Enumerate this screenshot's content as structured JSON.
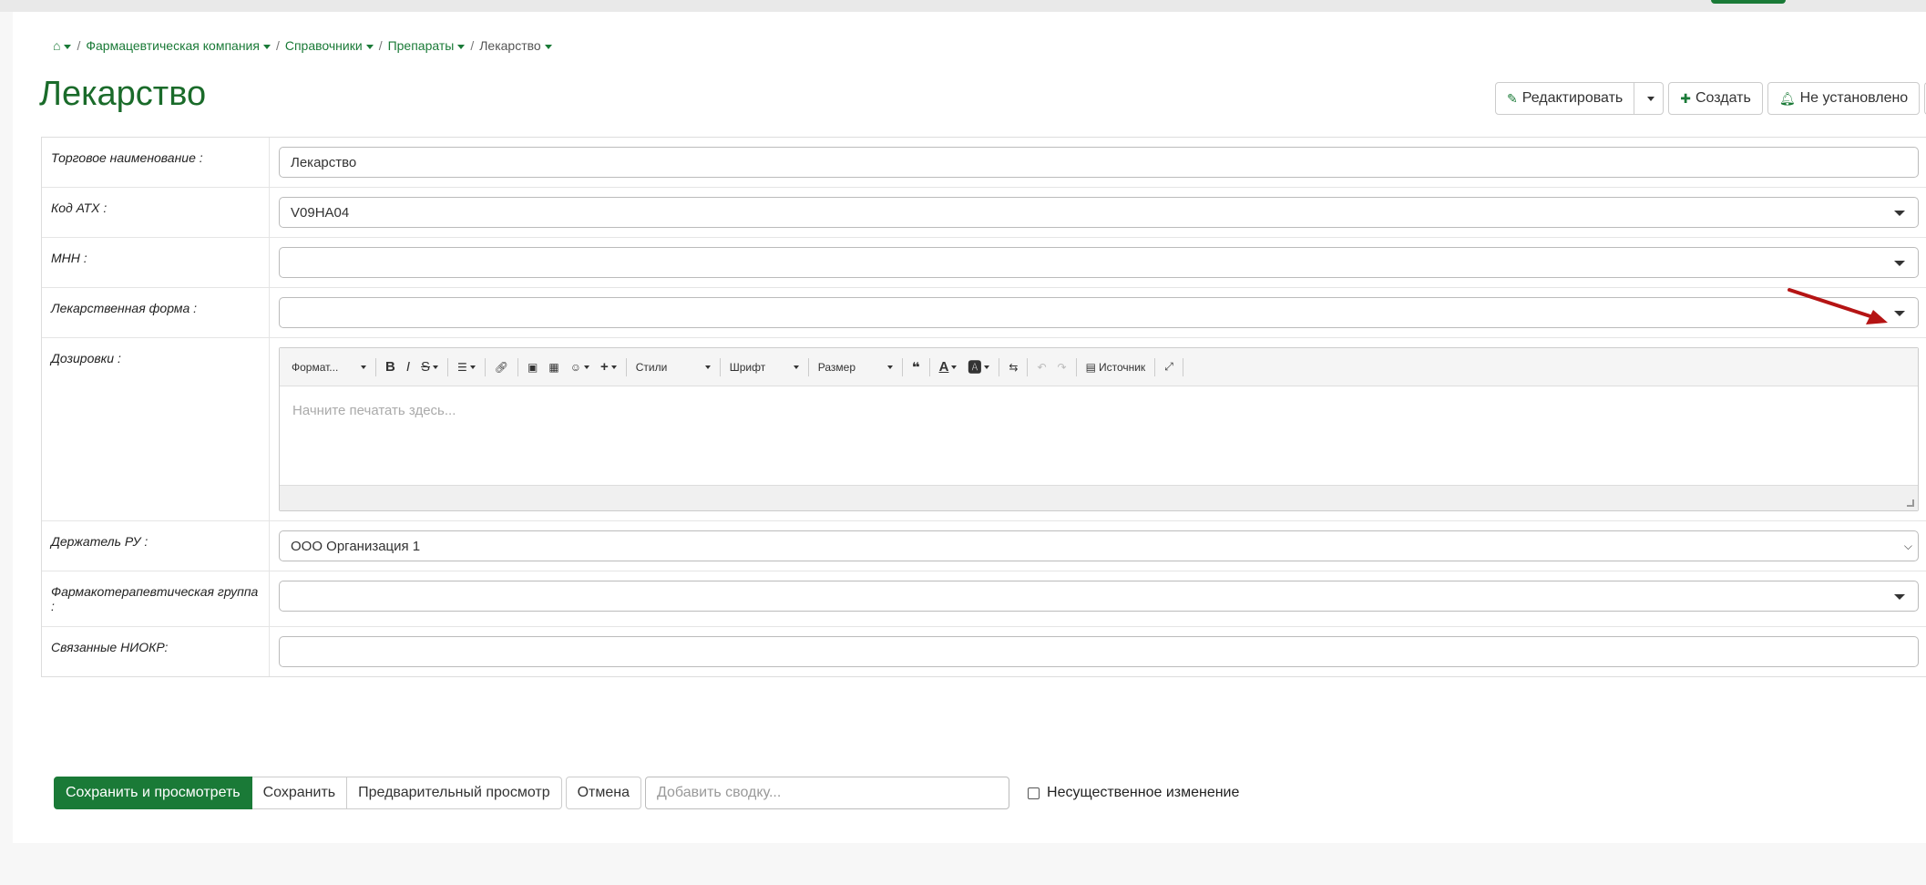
{
  "breadcrumb": {
    "items": [
      "Фармацевтическая компания",
      "Справочники",
      "Препараты"
    ],
    "current": "Лекарство"
  },
  "page": {
    "title": "Лекарство"
  },
  "actions": {
    "edit": "Редактировать",
    "create": "Создать",
    "notify": "Не установлено"
  },
  "fields": {
    "trade_name": {
      "label": "Торговое наименование :",
      "value": "Лекарство"
    },
    "atc": {
      "label": "Код АТХ :",
      "value": "V09HA04"
    },
    "inn": {
      "label": "МНН :",
      "value": ""
    },
    "form": {
      "label": "Лекарственная форма :",
      "value": ""
    },
    "dosage": {
      "label": "Дозировки :",
      "placeholder": "Начните печатать здесь..."
    },
    "holder": {
      "label": "Держатель РУ :",
      "value": "ООО Организация 1"
    },
    "pharm_group": {
      "label": "Фармакотерапевтическая группа :",
      "value": ""
    },
    "research": {
      "label": "Связанные НИОКР:",
      "value": ""
    }
  },
  "editor_toolbar": {
    "format": "Формат...",
    "styles": "Стили",
    "font": "Шрифт",
    "size": "Размер",
    "source": "Источник"
  },
  "bottom": {
    "save_view": "Сохранить и просмотреть",
    "save": "Сохранить",
    "preview": "Предварительный просмотр",
    "cancel": "Отмена",
    "summary_placeholder": "Добавить сводку...",
    "minor_change": "Несущественное изменение"
  },
  "colors": {
    "accent": "#1a7a37",
    "title": "#1a6b2a",
    "arrow": "#b51414"
  }
}
